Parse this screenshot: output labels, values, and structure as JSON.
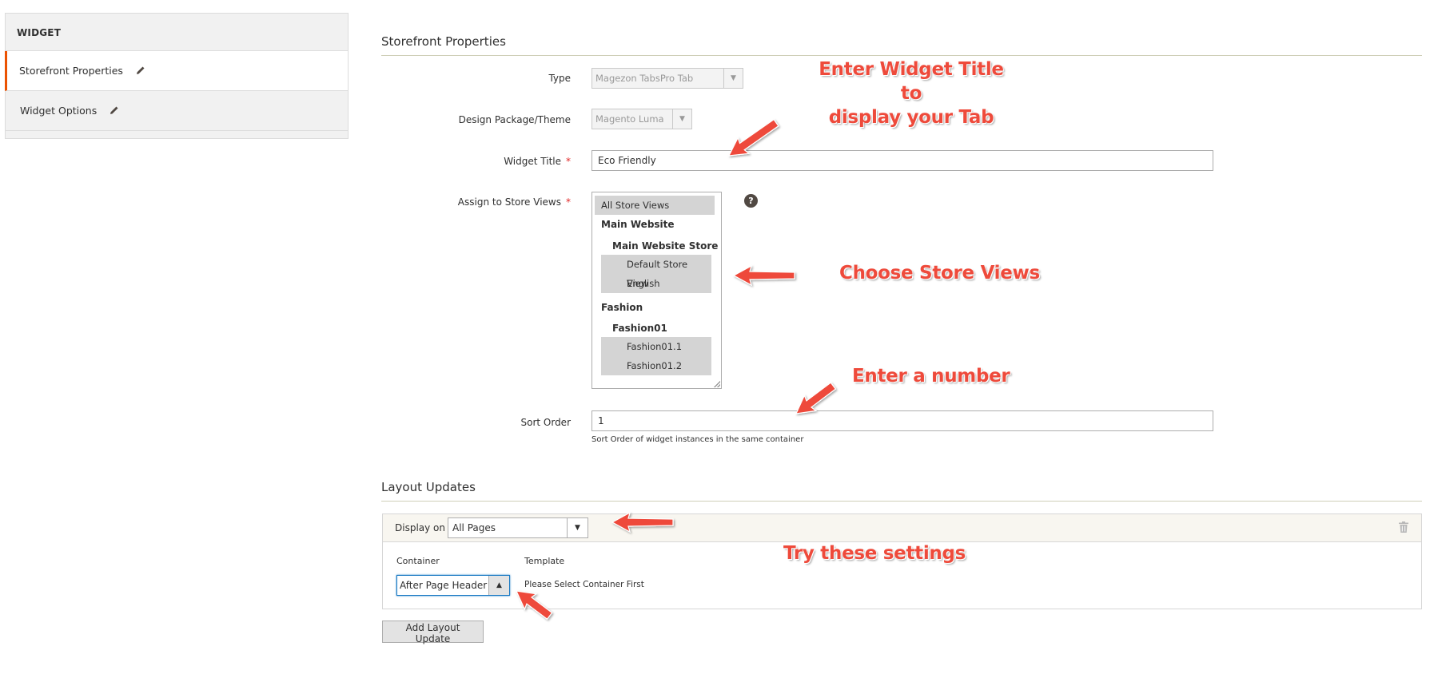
{
  "sidebar": {
    "header": "WIDGET",
    "items": [
      {
        "label": "Storefront Properties",
        "active": true
      },
      {
        "label": "Widget Options",
        "active": false
      }
    ]
  },
  "storefront": {
    "title": "Storefront Properties",
    "type_label": "Type",
    "type_value": "Magezon TabsPro Tab",
    "design_label": "Design Package/Theme",
    "design_value": "Magento Luma",
    "title_label": "Widget Title",
    "title_value": "Eco Friendly",
    "store_label": "Assign to Store Views",
    "store_options": [
      {
        "label": "All Store Views",
        "kind": "sel"
      },
      {
        "label": "Main Website",
        "kind": "group"
      },
      {
        "label": "Main Website Store",
        "kind": "sub-group"
      },
      {
        "label": "Default Store View",
        "kind": "sel-leaf"
      },
      {
        "label": "English",
        "kind": "sel-leaf"
      },
      {
        "label": "Fashion",
        "kind": "group"
      },
      {
        "label": "Fashion01",
        "kind": "sub-group"
      },
      {
        "label": "Fashion01.1",
        "kind": "sel-leaf"
      },
      {
        "label": "Fashion01.2",
        "kind": "sel-leaf"
      }
    ],
    "help_glyph": "?",
    "sort_label": "Sort Order",
    "sort_value": "1",
    "sort_note": "Sort Order of widget instances in the same container",
    "required_mark": "*"
  },
  "layout": {
    "title": "Layout Updates",
    "display_label": "Display on",
    "display_value": "All Pages",
    "container_label": "Container",
    "container_value": "After Page Header",
    "template_label": "Template",
    "template_note": "Please Select Container First",
    "add_button": "Add Layout Update"
  },
  "annotations": {
    "title_hint_line1": "Enter Widget Title to",
    "title_hint_line2": "display your Tab",
    "store_hint": "Choose Store Views",
    "sort_hint": "Enter a number",
    "settings_hint": "Try these settings"
  },
  "colors": {
    "accent": "#eb5202",
    "annotation": "#ee4a3b",
    "required": "#e22626",
    "focus": "#1979c3"
  }
}
